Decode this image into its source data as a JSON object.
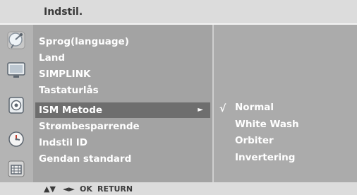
{
  "header": {
    "title": "Indstil."
  },
  "sidebar_icons": [
    {
      "icon": "satellite-dish-icon"
    },
    {
      "icon": "tv-screen-icon"
    },
    {
      "icon": "speaker-icon"
    },
    {
      "icon": "clock-icon"
    },
    {
      "icon": "lock-icon"
    }
  ],
  "menu": {
    "items": [
      {
        "label": "Sprog(language)"
      },
      {
        "label": "Land"
      },
      {
        "label": "SIMPLINK"
      },
      {
        "label": "Tastaturlås"
      },
      {
        "label": "ISM Metode",
        "arrow": "►"
      },
      {
        "label": "Strømbesparrende"
      },
      {
        "label": "Indstil ID"
      },
      {
        "label": "Gendan standard"
      }
    ]
  },
  "options": {
    "check_mark": "√",
    "items": [
      {
        "label": "Normal"
      },
      {
        "label": "White Wash"
      },
      {
        "label": "Orbiter"
      },
      {
        "label": "Invertering"
      }
    ]
  },
  "footer": {
    "updown": "▲▼",
    "leftright": "◄►",
    "ok": "OK",
    "return": "RETURN"
  },
  "colors": {
    "panel_bg": "#ababab",
    "selected_bg": "#6e6e6e",
    "title_bg": "#dcdcdc"
  }
}
